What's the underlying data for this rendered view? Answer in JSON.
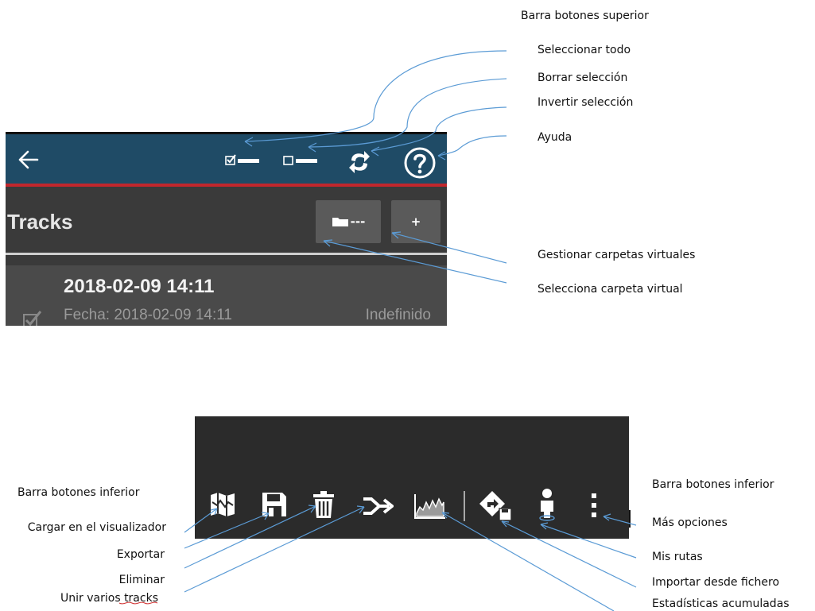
{
  "top": {
    "label_bar": "Barra botones superior",
    "label_select_all": "Seleccionar todo",
    "label_clear_selection": "Borrar selección",
    "label_invert_selection": "Invertir selección",
    "label_help": "Ayuda",
    "label_manage_folders": "Gestionar carpetas virtuales",
    "label_select_folder": "Selecciona carpeta virtual",
    "title": "Tracks",
    "folder_button": "---",
    "add_button": "+",
    "row_title": "2018-02-09 14:11",
    "row_date": "Fecha: 2018-02-09 14:11",
    "row_status": "Indefinido"
  },
  "bottom": {
    "label_bar_left": "Barra botones inferior",
    "label_load_viewer": "Cargar en el visualizador",
    "label_export": "Exportar",
    "label_delete": "Eliminar",
    "label_merge": "Unir varios tracks",
    "label_bar_right": "Barra botones inferior",
    "label_more": "Más opciones",
    "label_my_routes": "Mis rutas",
    "label_import": "Importar desde fichero",
    "label_stats": "Estadísticas acumuladas"
  },
  "colors": {
    "top_bar": "#1f4b66",
    "accent_red": "#c1272d",
    "dark_bg": "#3a3a3a",
    "arrow": "#5b9bd5"
  },
  "icons": [
    "back-arrow-icon",
    "select-all-icon",
    "clear-selection-icon",
    "invert-selection-icon",
    "help-icon",
    "folder-icon",
    "plus-icon",
    "checkbox-icon",
    "map-icon",
    "save-icon",
    "trash-icon",
    "merge-icon",
    "stats-icon",
    "import-icon",
    "my-routes-icon",
    "more-options-icon"
  ]
}
